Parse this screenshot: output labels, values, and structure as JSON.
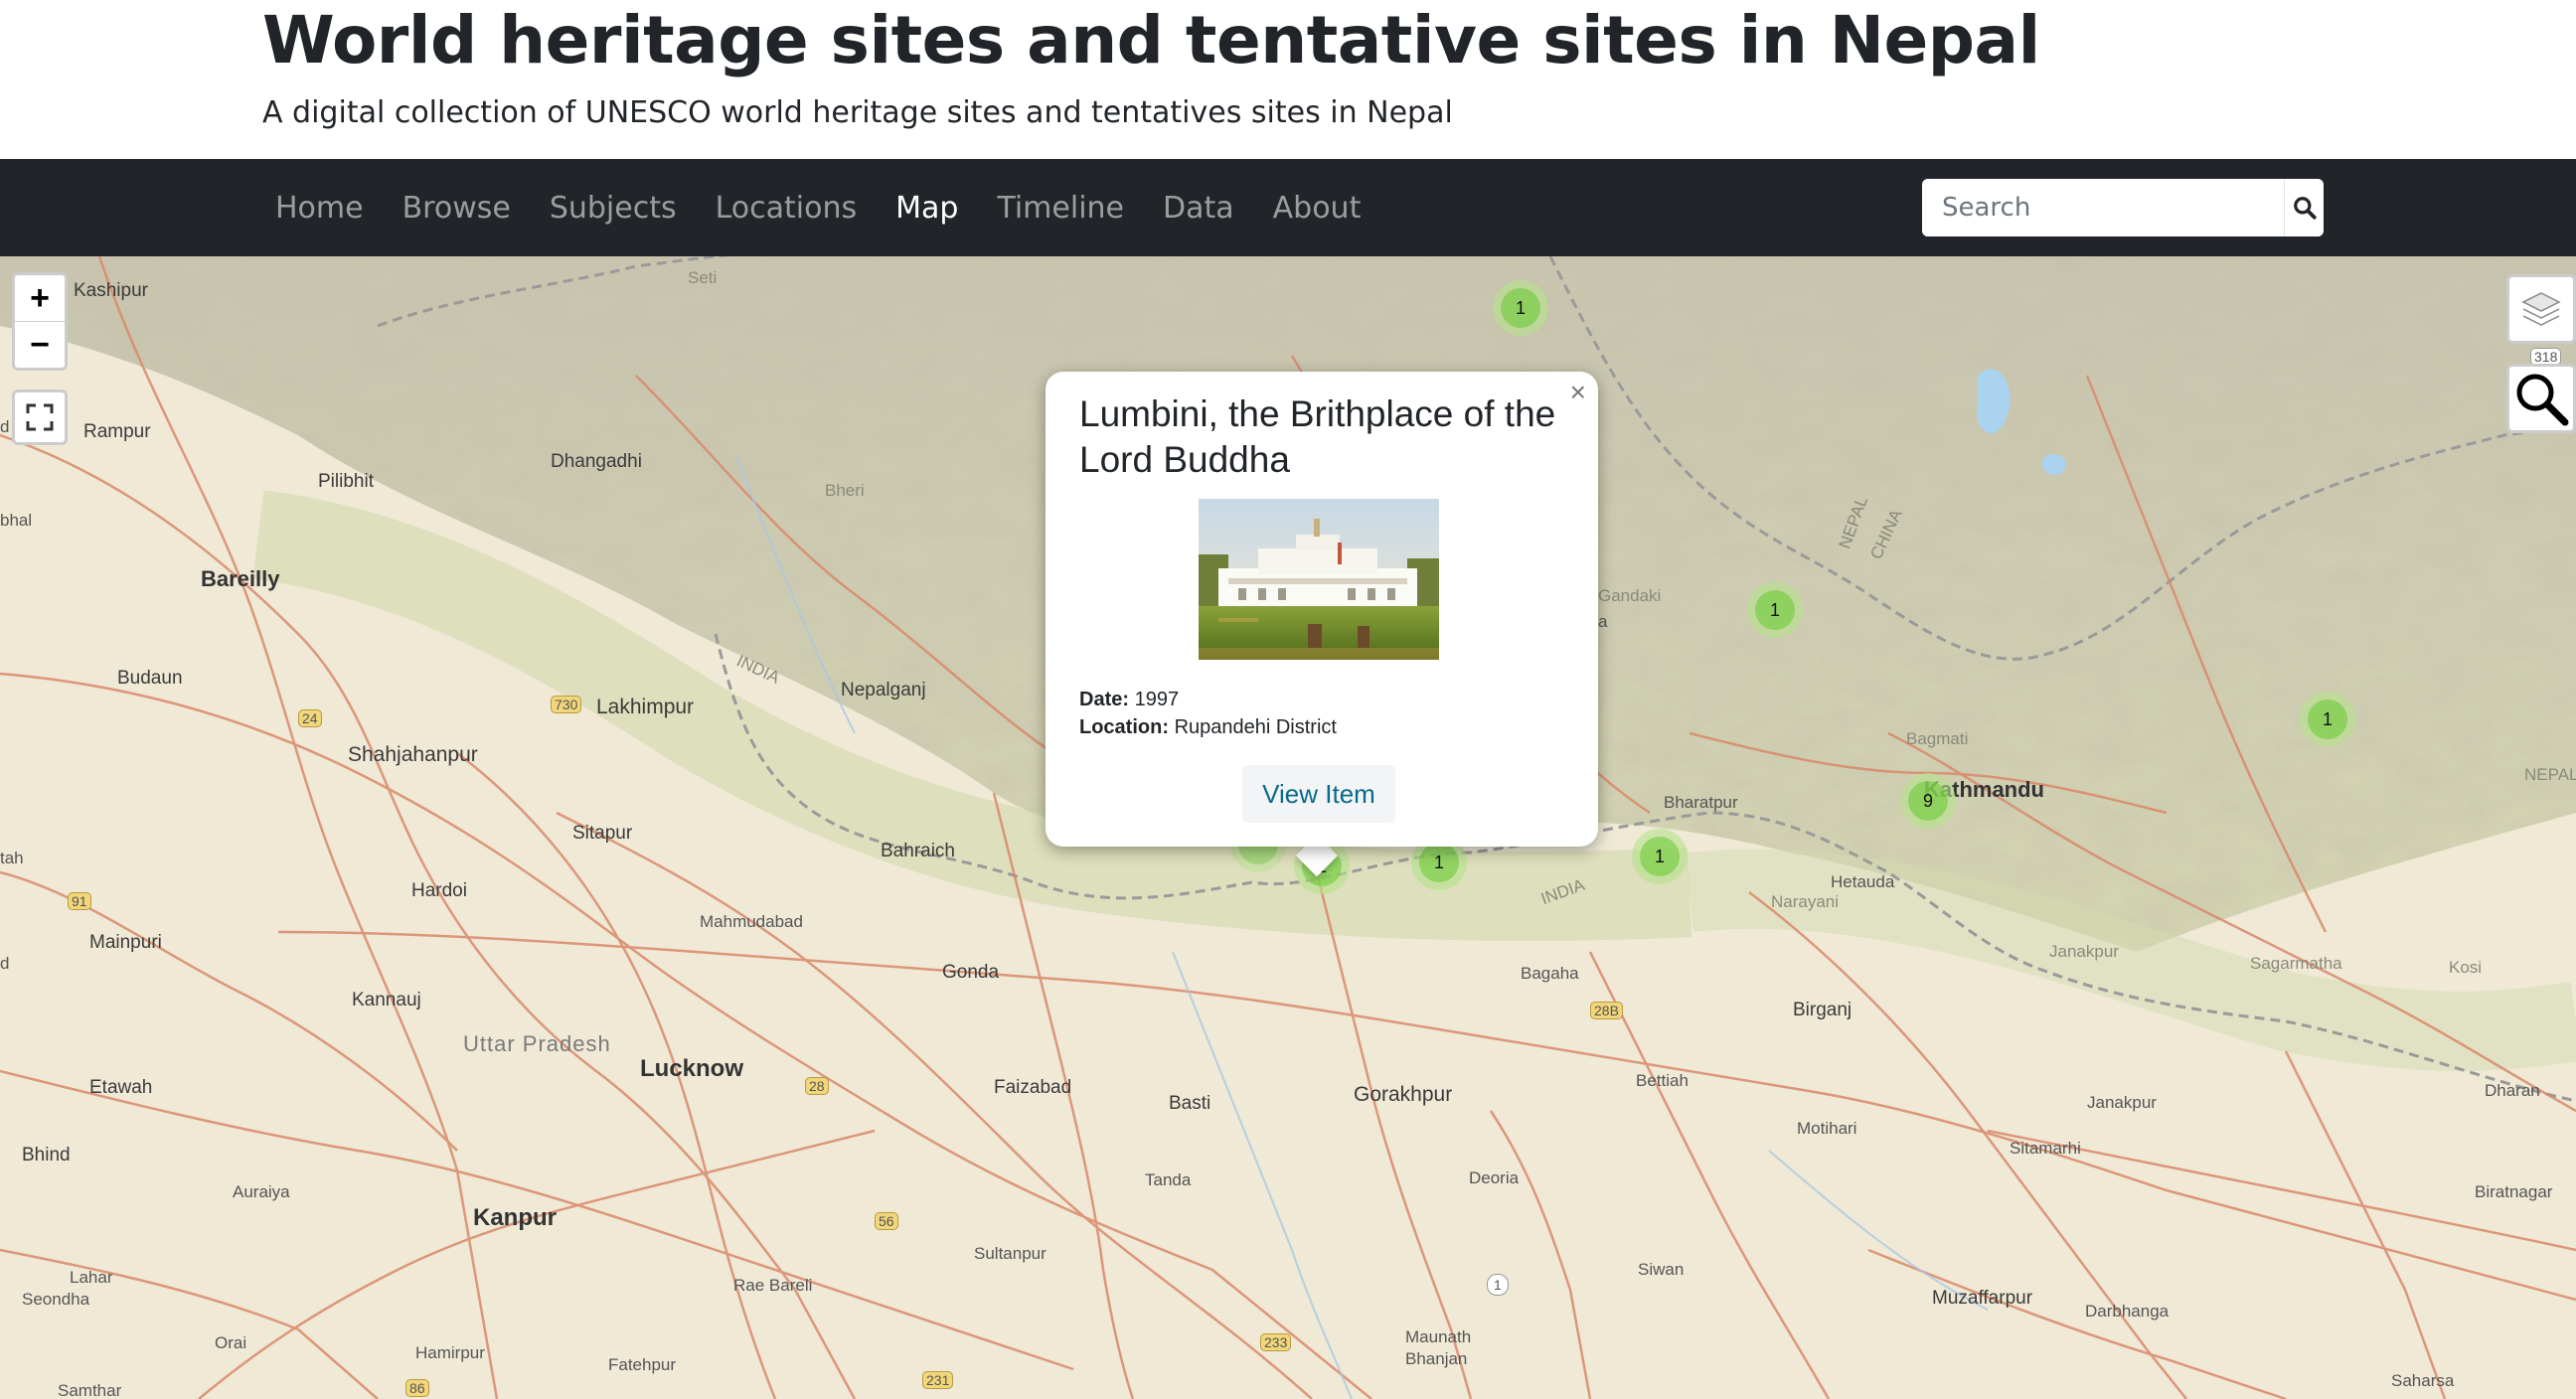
{
  "header": {
    "title": "World heritage sites and tentative sites in Nepal",
    "subtitle": "A digital collection of UNESCO world heritage sites and tentatives sites in Nepal"
  },
  "nav": {
    "items": [
      {
        "label": "Home",
        "active": false
      },
      {
        "label": "Browse",
        "active": false
      },
      {
        "label": "Subjects",
        "active": false
      },
      {
        "label": "Locations",
        "active": false
      },
      {
        "label": "Map",
        "active": true
      },
      {
        "label": "Timeline",
        "active": false
      },
      {
        "label": "Data",
        "active": false
      },
      {
        "label": "About",
        "active": false
      }
    ],
    "search_placeholder": "Search",
    "search_icon": "search-icon"
  },
  "map": {
    "controls": {
      "zoom_in": "+",
      "zoom_out": "−",
      "fullscreen_icon": "fullscreen-icon",
      "layers_icon": "layers-icon",
      "map_search_icon": "magnifier-icon"
    },
    "labels": {
      "kashipur": "Kashipur",
      "seti": "Seti",
      "rampur": "Rampur",
      "pilibhit": "Pilibhit",
      "dhangadhi": "Dhangadhi",
      "bheri": "Bheri",
      "bareilly": "Bareilly",
      "budaun": "Budaun",
      "lakhimpur": "Lakhimpur",
      "nepalganj": "Nepalganj",
      "shahjahanpur": "Shahjahanpur",
      "sitapur": "Sitapur",
      "bahraich": "Bahraich",
      "hardoi": "Hardoi",
      "mahmudabad": "Mahmudabad",
      "mainpuri": "Mainpuri",
      "kannauj": "Kannauj",
      "gonda": "Gonda",
      "uttar_pradesh": "Uttar Pradesh",
      "lucknow": "Lucknow",
      "faizabad": "Faizabad",
      "basti": "Basti",
      "gorakhpur": "Gorakhpur",
      "etawah": "Etawah",
      "bhind": "Bhind",
      "auraiya": "Auraiya",
      "tanda": "Tanda",
      "deoria": "Deoria",
      "kanpur": "Kanpur",
      "sultanpur": "Sultanpur",
      "rae_bareli": "Rae Bareli",
      "lahar": "Lahar",
      "seondha": "Seondha",
      "orai": "Orai",
      "hamirpur": "Hamirpur",
      "fatehpur": "Fatehpur",
      "samthar": "Samthar",
      "maunath": "Maunath",
      "bhanjan": "Bhanjan",
      "bagaha": "Bagaha",
      "bharatpur": "Bharatpur",
      "kathmandu": "Kathmandu",
      "hetauda": "Hetauda",
      "narayani": "Narayani",
      "birganj": "Birganj",
      "bettiah": "Bettiah",
      "motihari": "Motihari",
      "siwan": "Siwan",
      "muzaffarpur": "Muzaffarpur",
      "darbhanga": "Darbhanga",
      "sitamarhi": "Sitamarhi",
      "janakpur_zone": "Janakpur",
      "janakpur": "Janakpur",
      "sagarmatha": "Sagarmatha",
      "kosi": "Kosi",
      "dharan": "Dharan",
      "biratnagar": "Biratnagar",
      "saharsa": "Saharsa",
      "gandaki": "Gandaki",
      "bagmati": "Bagmati",
      "india_1": "INDIA",
      "india_2": "INDIA",
      "nepal_1": "NEPAL",
      "nepal_2": "NEPAL",
      "china": "CHINA",
      "bhal": "bhal",
      "tah": "tah",
      "d1": "d",
      "d2": "d",
      "a": "a",
      "r730": "730",
      "r24": "24",
      "r91": "91",
      "r28": "28",
      "r56": "56",
      "r233": "233",
      "r231": "231",
      "r86": "86",
      "r28b": "28B",
      "r318": "318",
      "r1": "1"
    },
    "clusters": [
      {
        "count": "1"
      },
      {
        "count": "1"
      },
      {
        "count": "1"
      },
      {
        "count": "9"
      },
      {
        "count": "1"
      },
      {
        "count": "1"
      },
      {
        "count": "1"
      }
    ]
  },
  "popup": {
    "title": "Lumbini, the Brithplace of the Lord Buddha",
    "close_label": "×",
    "date_label": "Date:",
    "date_value": "1997",
    "location_label": "Location:",
    "location_value": "Rupandehi District",
    "button_label": "View Item"
  }
}
